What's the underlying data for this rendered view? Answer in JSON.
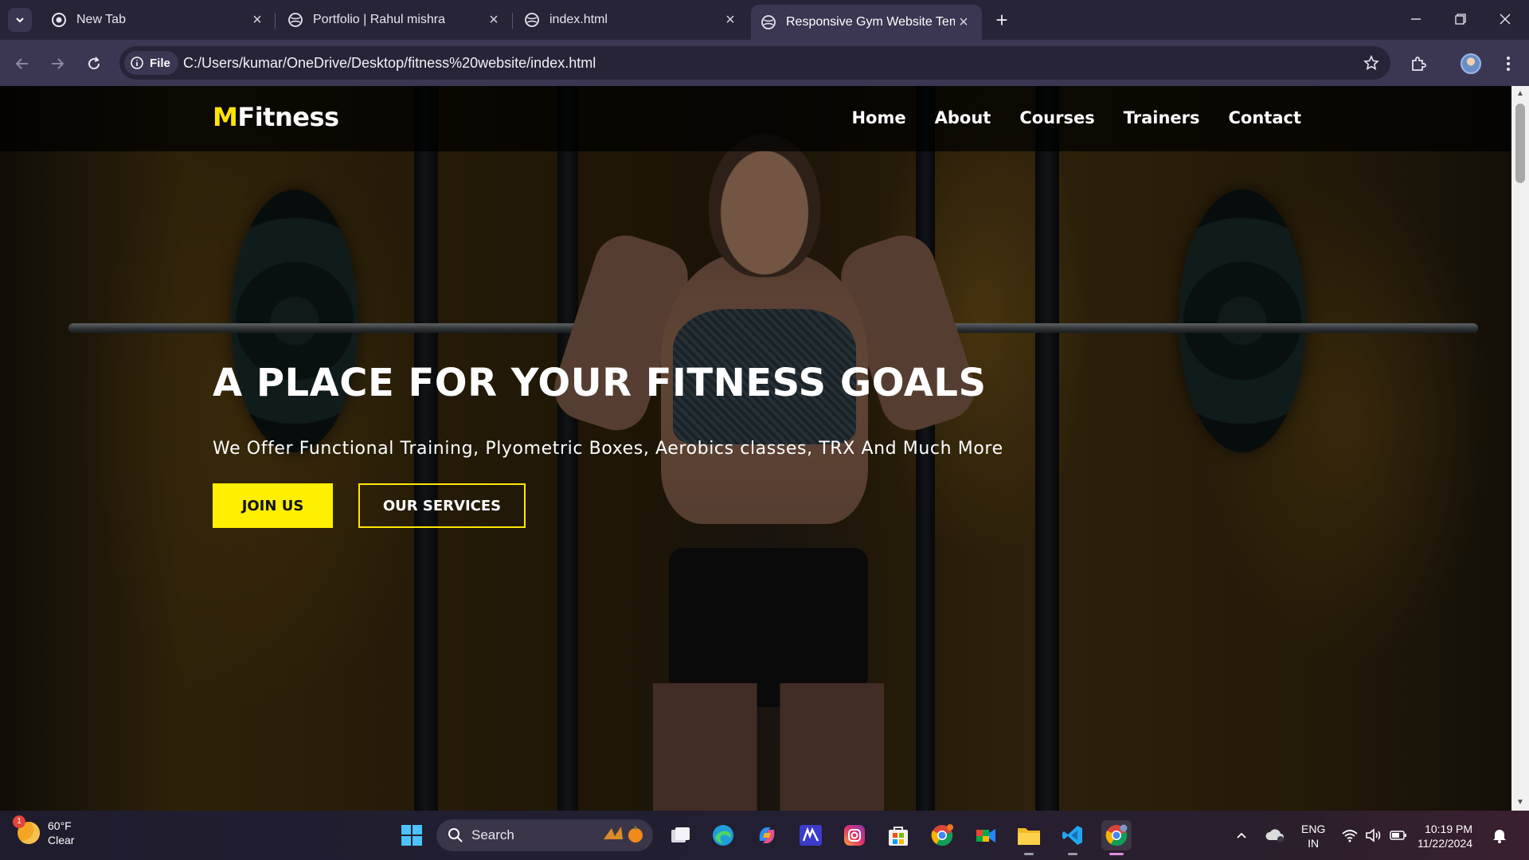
{
  "browser": {
    "tabs": [
      {
        "title": "New Tab",
        "favicon": "chrome-icon",
        "active": false
      },
      {
        "title": "Portfolio | Rahul mishra",
        "favicon": "globe-icon",
        "active": false
      },
      {
        "title": "index.html",
        "favicon": "globe-icon",
        "active": false
      },
      {
        "title": "Responsive Gym Website Templ",
        "favicon": "globe-icon",
        "active": true
      }
    ],
    "chip_label": "File",
    "url": "C:/Users/kumar/OneDrive/Desktop/fitness%20website/index.html"
  },
  "site": {
    "logo_accent": "M",
    "logo_rest": "Fitness",
    "nav": [
      "Home",
      "About",
      "Courses",
      "Trainers",
      "Contact"
    ],
    "hero_title": "A PLACE FOR YOUR FITNESS GOALS",
    "hero_subtitle": "We Offer Functional Training, Plyometric Boxes, Aerobics classes, TRX And Much More",
    "primary_button": "JOIN US",
    "secondary_button": "OUR SERVICES",
    "accent_color": "#ffef00"
  },
  "taskbar": {
    "weather_badge": "1",
    "weather_temp": "60°F",
    "weather_desc": "Clear",
    "search_placeholder": "Search",
    "lang_top": "ENG",
    "lang_bottom": "IN",
    "time": "10:19 PM",
    "date": "11/22/2024"
  }
}
